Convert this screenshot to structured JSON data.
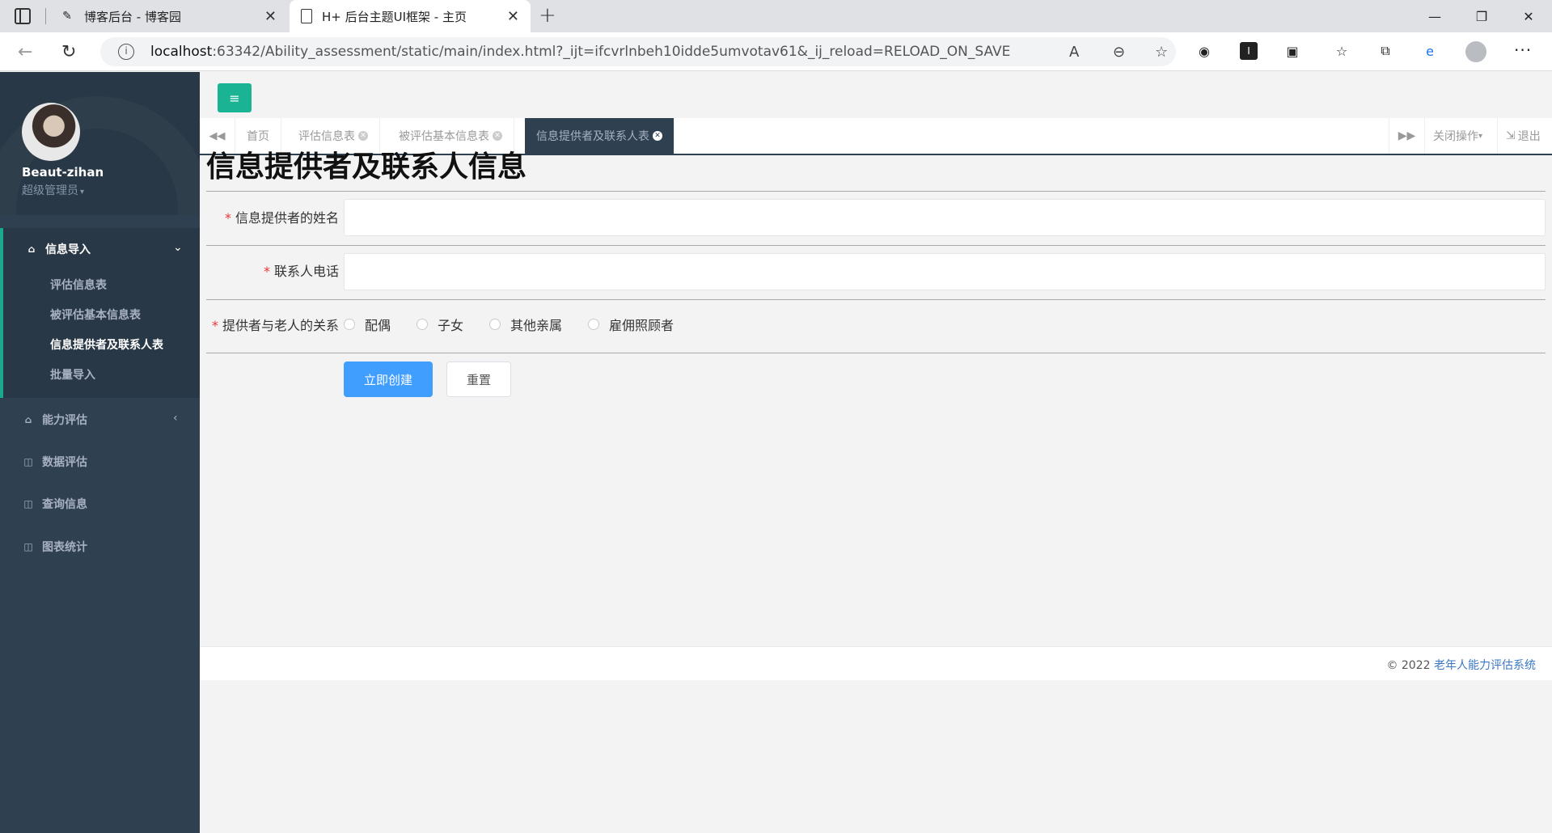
{
  "browser": {
    "tabs": [
      {
        "title": "博客后台 - 博客园",
        "icon": "blog-icon"
      },
      {
        "title": "H+ 后台主题UI框架 - 主页",
        "icon": "page-icon"
      }
    ],
    "url_host": "localhost",
    "url_path": ":63342/Ability_assessment/static/main/index.html?_ijt=ifcvrlnbeh10idde5umvotav61&_ij_reload=RELOAD_ON_SAVE"
  },
  "sidebar": {
    "user_name": "Beaut-zihan",
    "user_role": "超级管理员",
    "menu": [
      {
        "label": "信息导入",
        "icon": "home-icon",
        "open": true,
        "children": [
          "评估信息表",
          "被评估基本信息表",
          "信息提供者及联系人表",
          "批量导入"
        ],
        "active_child": 2
      },
      {
        "label": "能力评估",
        "icon": "home-icon"
      },
      {
        "label": "数据评估",
        "icon": "table-icon"
      },
      {
        "label": "查询信息",
        "icon": "table-icon"
      },
      {
        "label": "图表统计",
        "icon": "table-icon"
      }
    ]
  },
  "page_tabs": [
    {
      "label": "首页",
      "closable": false
    },
    {
      "label": "评估信息表",
      "closable": true
    },
    {
      "label": "被评估基本信息表",
      "closable": true
    },
    {
      "label": "信息提供者及联系人表",
      "closable": true,
      "active": true
    }
  ],
  "tabs_right": {
    "close_ops": "关闭操作",
    "logout": "退出"
  },
  "form": {
    "title": "信息提供者及联系人信息",
    "name_label": "信息提供者的姓名",
    "name_value": "",
    "phone_label": "联系人电话",
    "phone_value": "",
    "relation_label": "提供者与老人的关系",
    "relation_options": [
      "配偶",
      "子女",
      "其他亲属",
      "雇佣照顾者"
    ],
    "submit_label": "立即创建",
    "reset_label": "重置"
  },
  "footer": {
    "copyright": "© 2022",
    "system_name": "老年人能力评估系统"
  },
  "colors": {
    "sidebar": "#2f4050",
    "accent": "#1ab394",
    "primary": "#409eff"
  }
}
